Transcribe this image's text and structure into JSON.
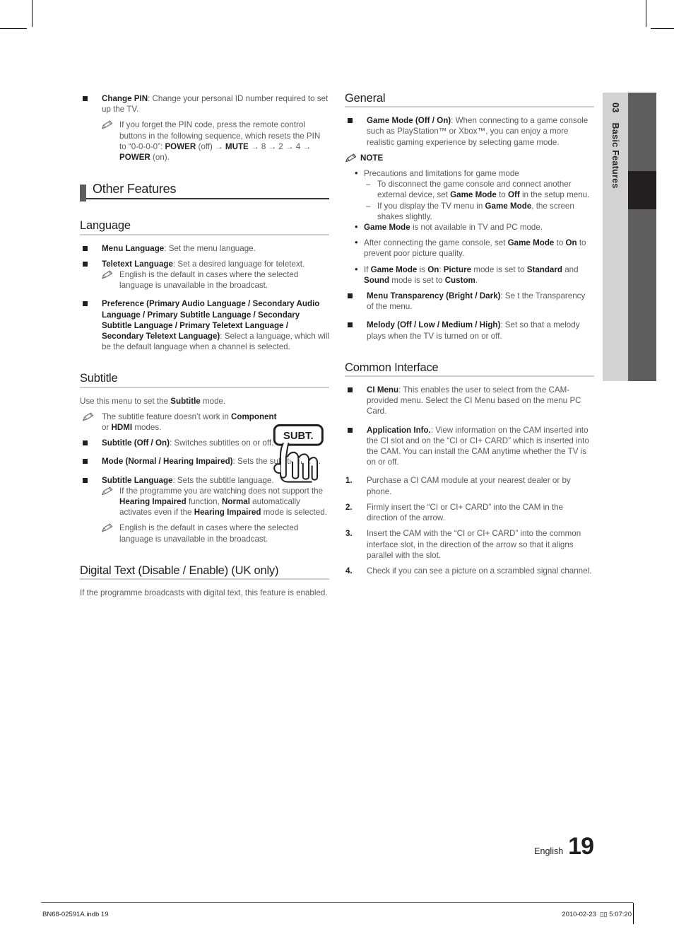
{
  "sidetab": {
    "number": "03",
    "label": "Basic Features"
  },
  "left_column": {
    "change_pin": {
      "term": "Change PIN",
      "desc": ": Change your personal ID number required to set up the TV.",
      "note": "If you forget the PIN code, press the remote control buttons in the following sequence, which resets the PIN to “0-0-0-0”: ",
      "note_b1": "POWER",
      "note_t1": " (off) → ",
      "note_b2": "MUTE",
      "note_t2": " → 8 → 2 → 4 → ",
      "note_b3": "POWER",
      "note_t3": " (on)."
    },
    "section_other_features": "Other Features",
    "language": {
      "heading": "Language",
      "menu_language_term": "Menu Language",
      "menu_language_desc": ": Set the menu language.",
      "teletext_language_term": "Teletext Language",
      "teletext_language_desc": ": Set a desired language for teletext.",
      "teletext_note": "English is the default in cases where the selected language is unavailable in the broadcast.",
      "preference_term": "Preference (Primary Audio Language / Secondary Audio Language / Primary Subtitle Language / Secondary Subtitle Language / Primary Teletext Language / Secondary Teletext Language)",
      "preference_desc": ": Select a language, which will be the default language when a channel is selected."
    },
    "subtitle": {
      "heading": "Subtitle",
      "intro_a": "Use this menu to set the ",
      "intro_b": "Subtitle",
      "intro_c": " mode.",
      "note1_a": "The subtitle feature doesn’t work in ",
      "note1_b": "Component",
      "note1_c": " or ",
      "note1_d": "HDMI",
      "note1_e": " modes.",
      "item1_term": "Subtitle (Off / On)",
      "item1_desc": ": Switches subtitles on or off.",
      "item2_term": "Mode (Normal / Hearing Impaired)",
      "item2_desc": ": Sets the subtitle mode.",
      "item3_term": "Subtitle Language",
      "item3_desc": ": Sets the subtitle language.",
      "note2_a": "If the programme you are watching does not support the ",
      "note2_b": "Hearing Impaired",
      "note2_c": " function, ",
      "note2_d": "Normal",
      "note2_e": " automatically activates even if the ",
      "note2_f": "Hearing Impaired",
      "note2_g": " mode is selected.",
      "note3": "English is the default in cases where the selected language is unavailable in the broadcast.",
      "remote_button_label": "SUBT."
    },
    "digital_text": {
      "heading": "Digital Text (Disable / Enable) (UK only)",
      "body": "If the programme broadcasts with digital text, this feature is enabled."
    }
  },
  "right_column": {
    "general": {
      "heading": "General",
      "game_mode_term": "Game Mode (Off / On)",
      "game_mode_desc": ": When connecting to a game console such as PlayStation™ or Xbox™, you can enjoy a more realistic gaming experience by selecting game mode.",
      "note_label": "NOTE",
      "note_bullet1": "Precautions and limitations for game mode",
      "note_dash1_a": "To disconnect the game console and connect another external device, set ",
      "note_dash1_b": "Game Mode",
      "note_dash1_c": " to ",
      "note_dash1_d": "Off",
      "note_dash1_e": " in the setup menu.",
      "note_dash2_a": "If you display the TV menu in ",
      "note_dash2_b": "Game Mode",
      "note_dash2_c": ", the screen shakes slightly.",
      "note_bullet2_a": "Game Mode",
      "note_bullet2_b": " is not available in TV and PC mode.",
      "note_bullet3_a": "After connecting the game console, set ",
      "note_bullet3_b": "Game Mode",
      "note_bullet3_c": " to ",
      "note_bullet3_d": "On",
      "note_bullet3_e": " to prevent poor picture quality.",
      "note_bullet4_a": "If ",
      "note_bullet4_b": "Game Mode",
      "note_bullet4_c": " is ",
      "note_bullet4_d": "On",
      "note_bullet4_e": ": ",
      "note_bullet4_f": "Picture",
      "note_bullet4_g": " mode is set to ",
      "note_bullet4_h": "Standard",
      "note_bullet4_i": " and ",
      "note_bullet4_j": "Sound",
      "note_bullet4_k": " mode is set to ",
      "note_bullet4_l": "Custom",
      "note_bullet4_m": ".",
      "menu_transparency_term": "Menu Transparency (Bright / Dark)",
      "menu_transparency_desc": ": Se t the Transparency of the menu.",
      "melody_term": "Melody (Off / Low / Medium / High)",
      "melody_desc": ": Set so that a melody plays when the TV is turned on or off."
    },
    "common_interface": {
      "heading": "Common Interface",
      "ci_menu_term": "CI Menu",
      "ci_menu_desc": ":  This enables the user to select from the CAM-provided menu. Select the CI Menu based on the menu PC Card.",
      "app_info_term": "Application Info.",
      "app_info_desc": ": View information on the CAM inserted into the CI slot and on the “CI or CI+ CARD” which is inserted into the CAM. You can install the CAM anytime whether the TV is on or off.",
      "steps": [
        {
          "n": "1.",
          "text": "Purchase a CI CAM module at your nearest dealer or by phone."
        },
        {
          "n": "2.",
          "text": "Firmly insert the “CI or CI+ CARD” into the CAM in the direction of the arrow."
        },
        {
          "n": "3.",
          "text": "Insert the CAM with the “CI or CI+ CARD” into the common interface slot, in the direction of the arrow so that it aligns parallel with the slot."
        },
        {
          "n": "4.",
          "text": "Check if you can see a picture on a scrambled signal channel."
        }
      ]
    }
  },
  "footer": {
    "language_label": "English",
    "page_number": "19",
    "file_info": "BN68-02591A.indb   19",
    "timestamp_date": "2010-02-23",
    "timestamp_glyph": "▯▯",
    "timestamp_time": "5:07:20"
  },
  "colors": {
    "body_text": "#58595b",
    "bold_text": "#231f20",
    "side_tab_bg": "#d2d2d2",
    "side_bar": "#5e5e5e",
    "side_bar_mark": "#231f20",
    "rule_light": "#cfcfcf",
    "rule_dark": "#3a3a3a"
  }
}
